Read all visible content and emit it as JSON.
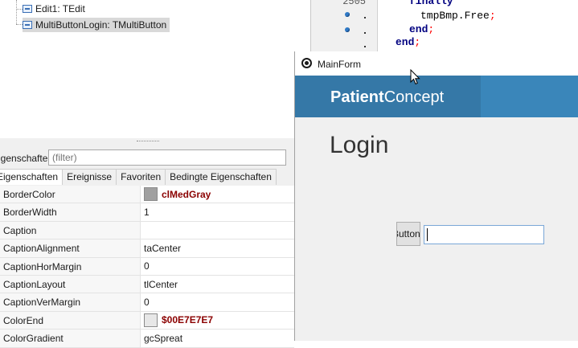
{
  "structure_tree": {
    "items": [
      {
        "label": "Edit1: TEdit",
        "selected": false
      },
      {
        "label": "MultiButtonLogin: TMultiButton",
        "selected": true
      }
    ]
  },
  "code_editor": {
    "line_number": "2505",
    "lines": [
      {
        "kw": "finally",
        "plain": "",
        "semi": ""
      },
      {
        "kw": "",
        "plain": "tmpBmp.Free",
        "semi": ";"
      },
      {
        "kw": "end",
        "plain": "",
        "semi": ";"
      },
      {
        "kw": "end",
        "plain": "",
        "semi": ";"
      }
    ]
  },
  "inspector": {
    "filter_label": "Eigenschaften",
    "filter_placeholder": "(filter)",
    "tabs": [
      "Eigenschaften",
      "Ereignisse",
      "Favoriten",
      "Bedingte Eigenschaften"
    ],
    "properties": [
      {
        "name": "BorderColor",
        "value": "clMedGray",
        "color": "#A0A0A0"
      },
      {
        "name": "BorderWidth",
        "value": "1"
      },
      {
        "name": "Caption",
        "value": ""
      },
      {
        "name": "CaptionAlignment",
        "value": "taCenter"
      },
      {
        "name": "CaptionHorMargin",
        "value": "0"
      },
      {
        "name": "CaptionLayout",
        "value": "tlCenter"
      },
      {
        "name": "CaptionVerMargin",
        "value": "0"
      },
      {
        "name": "ColorEnd",
        "value": "$00E7E7E7",
        "color": "#E7E7E7"
      },
      {
        "name": "ColorGradient",
        "value": "gcSpreat"
      }
    ]
  },
  "main_form": {
    "title": "MainForm",
    "brand_bold": "Patient",
    "brand_regular": "Concept",
    "heading": "Login",
    "button_caption": "Button",
    "edit_value": ""
  },
  "colors": {
    "banner": "#3A86BA",
    "value_red": "#8B0000"
  }
}
